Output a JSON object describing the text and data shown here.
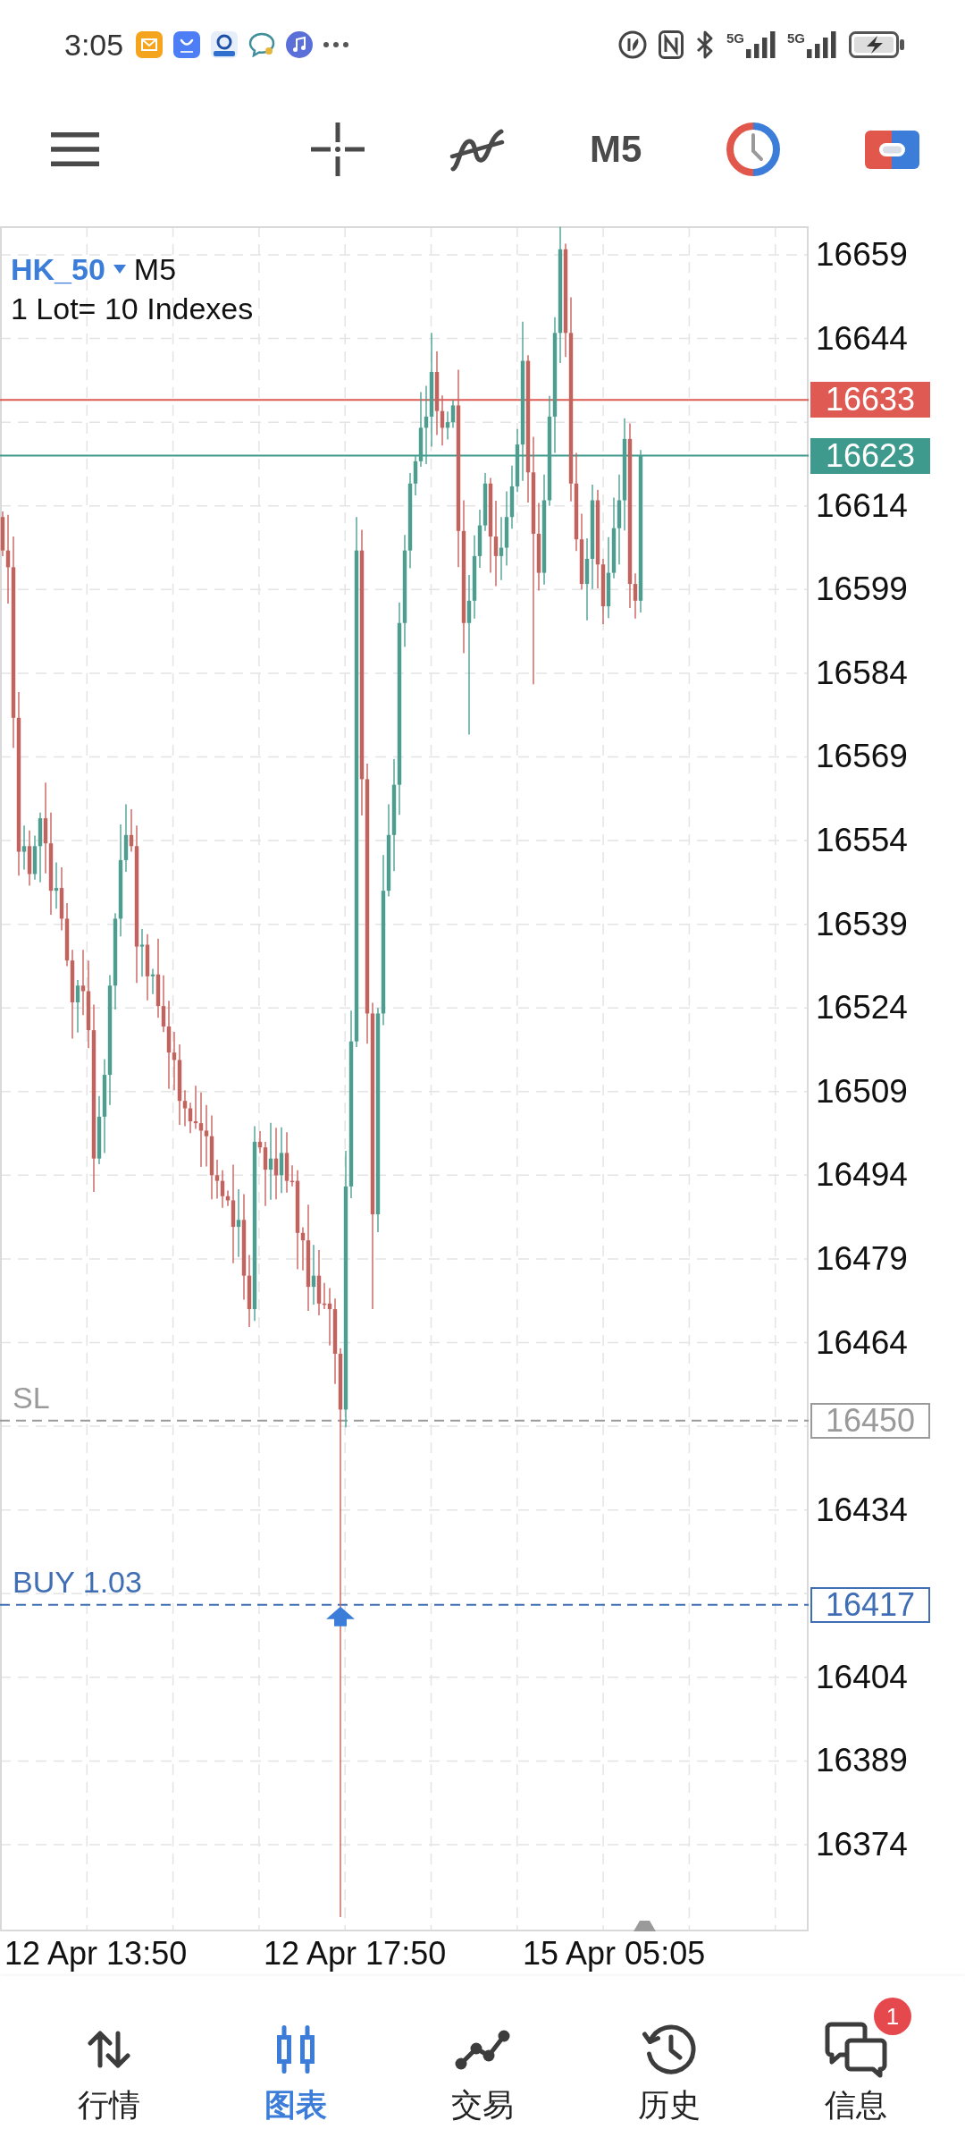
{
  "status_bar": {
    "time": "3:05",
    "network": [
      "5G",
      "5G"
    ]
  },
  "toolbar": {
    "timeframe": "M5"
  },
  "chart": {
    "symbol": "HK_50",
    "timeframe": "M5",
    "lot_info": "1 Lot= 10 Indexes",
    "price_ticks": [
      "16659",
      "16644",
      "16614",
      "16599",
      "16584",
      "16569",
      "16554",
      "16539",
      "16524",
      "16509",
      "16494",
      "16479",
      "16464",
      "16434",
      "16404",
      "16389",
      "16374"
    ],
    "price_lines": [
      {
        "kind": "solid",
        "color": "#de5a52",
        "tag": "16633",
        "entry_marker": false
      },
      {
        "kind": "solid",
        "color": "#3e9a8c",
        "tag": "16623",
        "entry_marker": false
      },
      {
        "kind": "dashed",
        "color": "#9a9a9a",
        "label": "SL",
        "tag": "16450",
        "entry_marker": false
      },
      {
        "kind": "dashed",
        "color": "#3f6eb5",
        "label": "BUY 1.03",
        "tag": "16417",
        "entry_marker": true
      }
    ],
    "time_labels": [
      "12 Apr 13:50",
      "12 Apr 17:50",
      "15 Apr 05:05"
    ]
  },
  "bottom_nav": [
    {
      "label": "行情",
      "selected": false
    },
    {
      "label": "图表",
      "selected": true
    },
    {
      "label": "交易",
      "selected": false
    },
    {
      "label": "历史",
      "selected": false
    },
    {
      "label": "信息",
      "selected": false,
      "badge": "1"
    }
  ]
}
